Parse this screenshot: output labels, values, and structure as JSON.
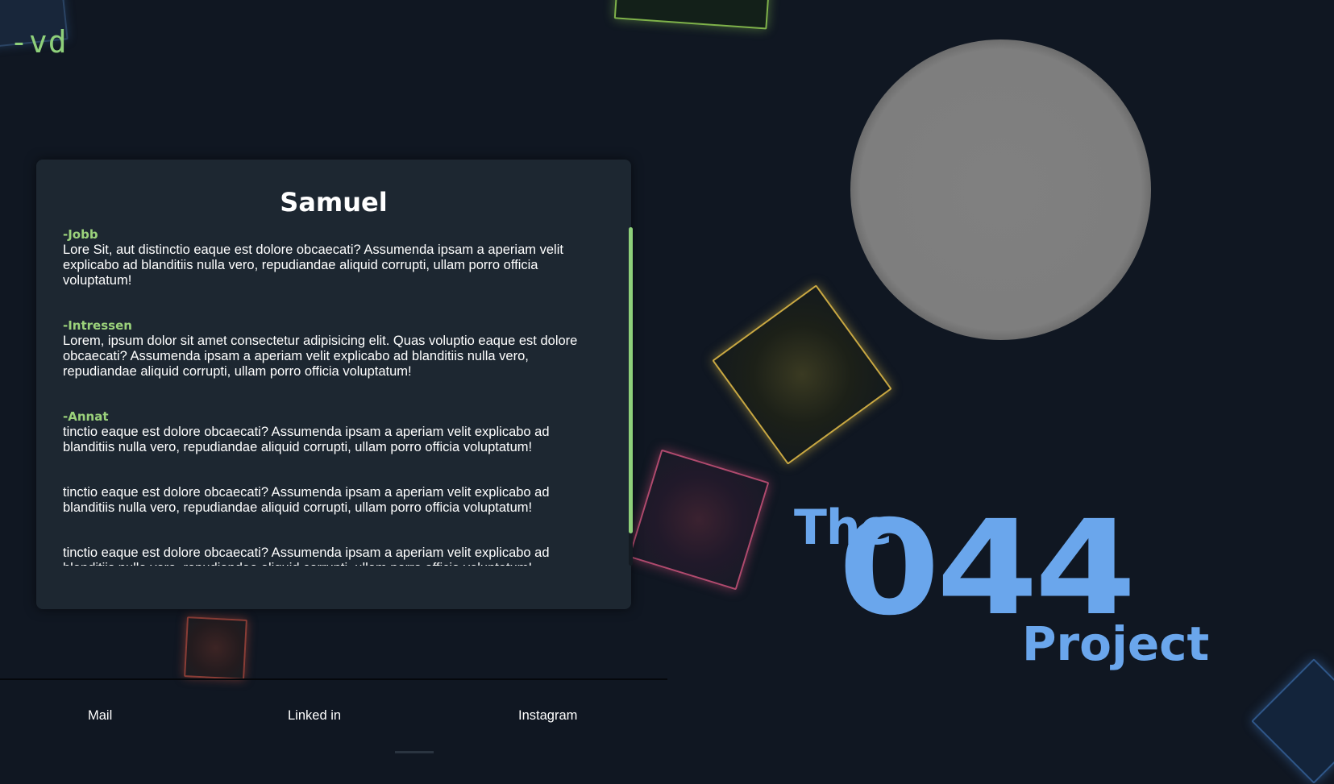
{
  "logo": {
    "text": "-vd"
  },
  "profile": {
    "name": "Samuel",
    "sections": [
      {
        "heading": "-Jobb",
        "text": "Lore Sit, aut distinctio eaque est dolore obcaecati? Assumenda ipsam a aperiam velit explicabo ad blanditiis nulla vero, repudiandae aliquid corrupti, ullam porro officia voluptatum!"
      },
      {
        "heading": "-Intressen",
        "text": "Lorem, ipsum dolor sit amet consectetur adipisicing elit. Quas voluptio eaque est dolore obcaecati? Assumenda ipsam a aperiam velit explicabo ad blanditiis nulla vero, repudiandae aliquid corrupti, ullam porro officia voluptatum!"
      },
      {
        "heading": "-Annat",
        "text": "tinctio eaque est dolore obcaecati? Assumenda ipsam a aperiam velit explicabo ad blanditiis nulla vero, repudiandae aliquid corrupti, ullam porro officia voluptatum!"
      },
      {
        "heading": "",
        "text": "tinctio eaque est dolore obcaecati? Assumenda ipsam a aperiam velit explicabo ad blanditiis nulla vero, repudiandae aliquid corrupti, ullam porro officia voluptatum!"
      },
      {
        "heading": "",
        "text": "tinctio eaque est dolore obcaecati? Assumenda ipsam a aperiam velit explicabo ad blanditiis nulla vero, repudiandae aliquid corrupti, ullam porro officia voluptatum!"
      }
    ]
  },
  "brand": {
    "the": "The",
    "number": "044",
    "project": "Project"
  },
  "footer": {
    "links": [
      "Mail",
      "Linked in",
      "Instagram"
    ]
  },
  "colors": {
    "background": "#101722",
    "card": "#1d2731",
    "accent_green": "#8ed07a",
    "brand_blue": "#6aa6ec",
    "avatar_gray": "#808080"
  },
  "icons": [
    "avatar-placeholder"
  ]
}
